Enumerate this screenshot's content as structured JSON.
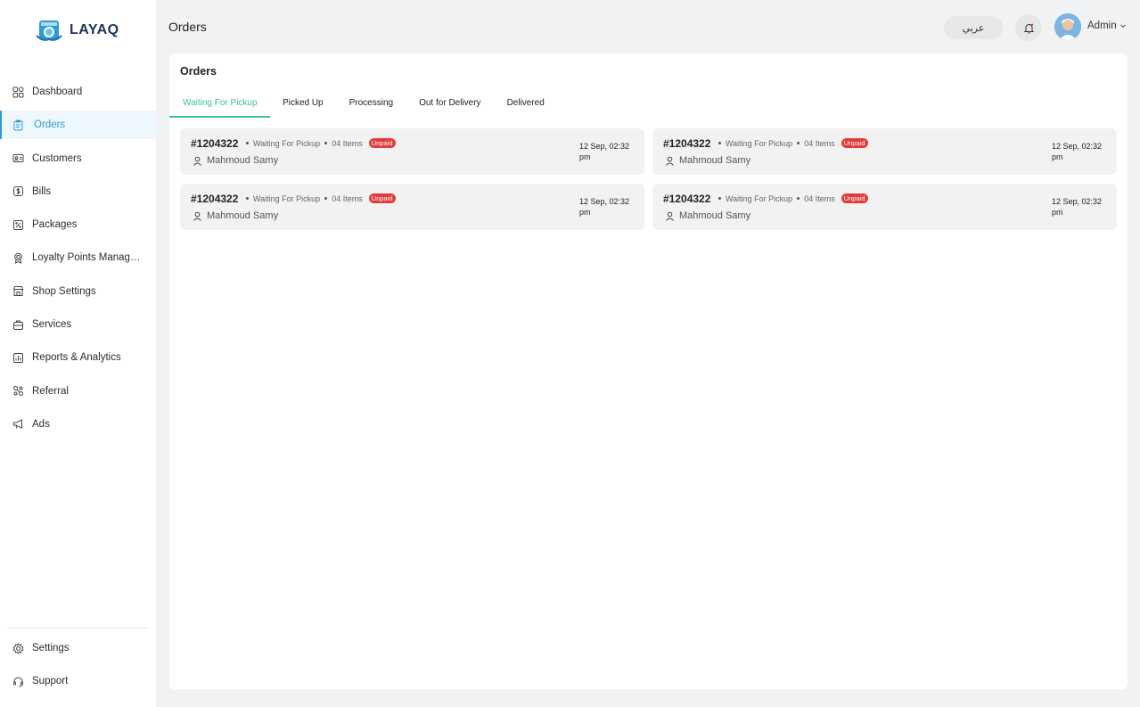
{
  "brand": {
    "name": "LAYAQ"
  },
  "sidebar": {
    "items": [
      {
        "label": "Dashboard",
        "icon": "dashboard-grid-icon",
        "active": false
      },
      {
        "label": "Orders",
        "icon": "clipboard-icon",
        "active": true
      },
      {
        "label": "Customers",
        "icon": "id-card-icon",
        "active": false
      },
      {
        "label": "Bills",
        "icon": "dollar-icon",
        "active": false
      },
      {
        "label": "Packages",
        "icon": "package-icon",
        "active": false
      },
      {
        "label": "Loyalty Points Manage...",
        "icon": "medal-icon",
        "active": false
      },
      {
        "label": "Shop Settings",
        "icon": "shop-icon",
        "active": false
      },
      {
        "label": "Services",
        "icon": "briefcase-icon",
        "active": false
      },
      {
        "label": "Reports & Analytics",
        "icon": "chart-icon",
        "active": false
      },
      {
        "label": "Referral",
        "icon": "referral-icon",
        "active": false
      },
      {
        "label": "Ads",
        "icon": "megaphone-icon",
        "active": false
      }
    ],
    "bottom": [
      {
        "label": "Settings",
        "icon": "gear-icon"
      },
      {
        "label": "Support",
        "icon": "headset-icon"
      }
    ]
  },
  "header": {
    "title": "Orders",
    "language_button": "عربي",
    "user_name": "Admin"
  },
  "panel": {
    "title": "Orders",
    "tabs": [
      {
        "label": "Waiting For Pickup",
        "active": true
      },
      {
        "label": "Picked Up",
        "active": false
      },
      {
        "label": "Processing",
        "active": false
      },
      {
        "label": "Out for Delivery",
        "active": false
      },
      {
        "label": "Delivered",
        "active": false
      }
    ],
    "orders": [
      {
        "id": "#1204322",
        "status": "Waiting For Pickup",
        "items": "04 Items",
        "payment": "Unpaid",
        "customer": "Mahmoud Samy",
        "date": "12 Sep, 02:32 pm"
      },
      {
        "id": "#1204322",
        "status": "Waiting For Pickup",
        "items": "04 Items",
        "payment": "Unpaid",
        "customer": "Mahmoud Samy",
        "date": "12 Sep, 02:32 pm"
      },
      {
        "id": "#1204322",
        "status": "Waiting For Pickup",
        "items": "04 Items",
        "payment": "Unpaid",
        "customer": "Mahmoud Samy",
        "date": "12 Sep, 02:32 pm"
      },
      {
        "id": "#1204322",
        "status": "Waiting For Pickup",
        "items": "04 Items",
        "payment": "Unpaid",
        "customer": "Mahmoud Samy",
        "date": "12 Sep, 02:32 pm"
      }
    ]
  },
  "colors": {
    "accent": "#2f9bd6",
    "tab_active": "#3cc28c",
    "unpaid_badge": "#e23b3b"
  }
}
